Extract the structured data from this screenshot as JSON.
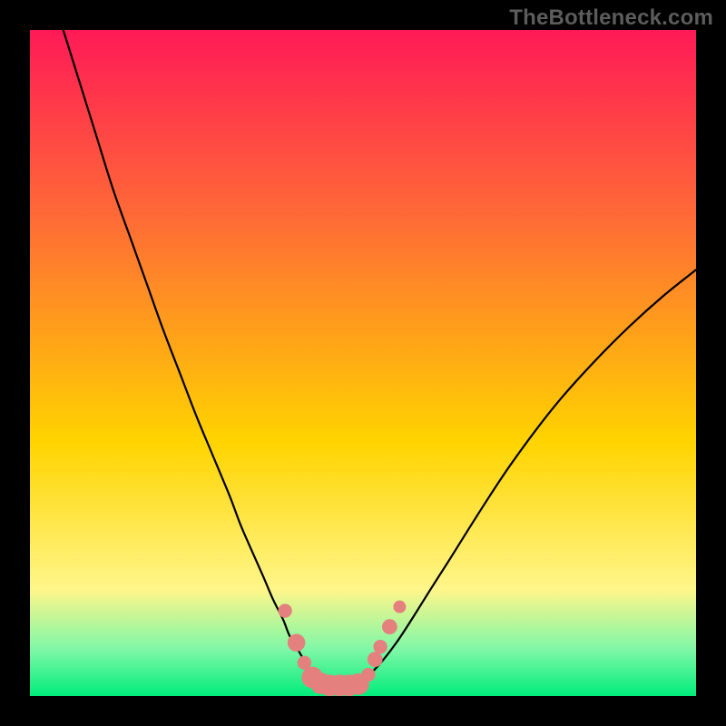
{
  "watermark": "TheBottleneck.com",
  "colors": {
    "frame": "#000000",
    "watermark": "#5c5c5c",
    "gradientTop": "#ff1a56",
    "gradientUpper": "#ff6a36",
    "gradientMid": "#ffd400",
    "gradientLowYellow": "#fff68a",
    "gradientLower": "#7ff7a6",
    "gradientBottom": "#00ed7c",
    "curve": "#000000",
    "marker": "#e4817f"
  },
  "chart_data": {
    "type": "line",
    "title": "",
    "xlabel": "",
    "ylabel": "",
    "xlim": [
      0,
      100
    ],
    "ylim": [
      0,
      100
    ],
    "series": [
      {
        "name": "bottleneck-curve",
        "x": [
          5,
          7.5,
          10,
          12.5,
          15,
          17.5,
          20,
          22.5,
          25,
          27.5,
          30,
          31.5,
          33,
          35,
          36.5,
          38,
          39,
          40.5,
          42,
          43,
          44.5,
          46,
          48,
          50,
          52.5,
          55,
          57.5,
          60,
          63,
          66,
          69,
          72,
          76,
          80,
          85,
          90,
          95,
          100
        ],
        "y": [
          100,
          92,
          84,
          76,
          69,
          62,
          55,
          48.5,
          42,
          36,
          30,
          26,
          22.5,
          18,
          14.5,
          11.5,
          9,
          6.5,
          4,
          2.6,
          1.8,
          1.6,
          1.6,
          2.4,
          4.8,
          8,
          11.8,
          15.8,
          20.5,
          25.3,
          30,
          34.5,
          40,
          45,
          50.5,
          55.5,
          60,
          64
        ]
      }
    ],
    "markers": {
      "name": "highlight-points",
      "points": [
        {
          "x": 38.3,
          "y": 12.8,
          "r": 1.1
        },
        {
          "x": 40.0,
          "y": 8.0,
          "r": 1.4
        },
        {
          "x": 41.2,
          "y": 5.0,
          "r": 1.1
        },
        {
          "x": 42.4,
          "y": 2.8,
          "r": 1.7
        },
        {
          "x": 43.7,
          "y": 1.9,
          "r": 1.7
        },
        {
          "x": 45.0,
          "y": 1.6,
          "r": 1.7
        },
        {
          "x": 46.5,
          "y": 1.6,
          "r": 1.7
        },
        {
          "x": 47.9,
          "y": 1.6,
          "r": 1.7
        },
        {
          "x": 49.3,
          "y": 1.8,
          "r": 1.7
        },
        {
          "x": 50.8,
          "y": 3.2,
          "r": 1.1
        },
        {
          "x": 51.8,
          "y": 5.5,
          "r": 1.2
        },
        {
          "x": 52.6,
          "y": 7.4,
          "r": 1.1
        },
        {
          "x": 54.0,
          "y": 10.4,
          "r": 1.2
        },
        {
          "x": 55.5,
          "y": 13.4,
          "r": 1.0
        }
      ]
    }
  }
}
